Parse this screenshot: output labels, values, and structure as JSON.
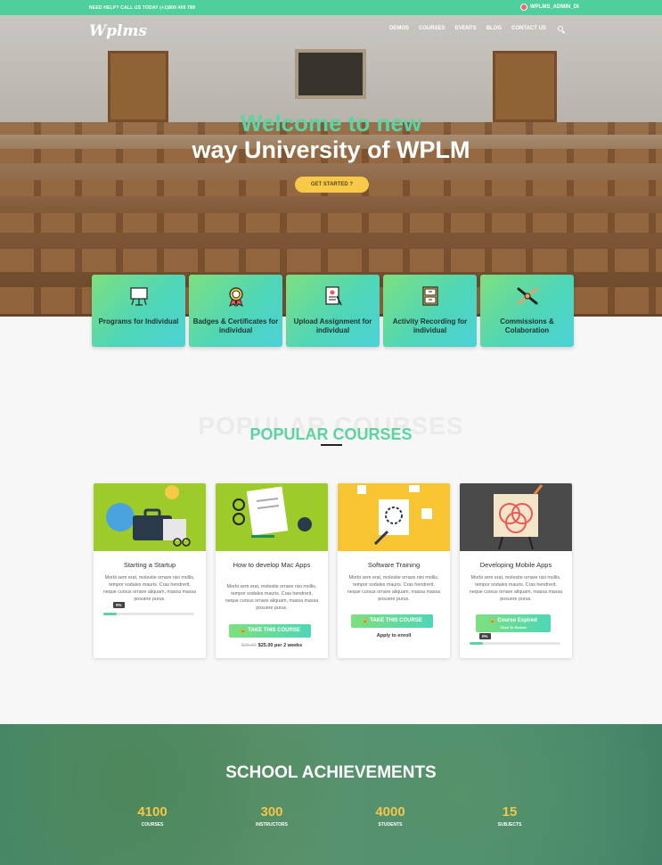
{
  "topbar": {
    "call": "NEED HELP? CALL US TODAY (+1)800 400 789",
    "user": "WPLMS_ADMIN_DI"
  },
  "header": {
    "logo": "Wplms",
    "nav": [
      "DEMOS",
      "COURSES",
      "EVENTS",
      "BLOG",
      "CONTACT US"
    ]
  },
  "hero": {
    "line1": "Welcome to new",
    "line2": "way University of WPLM",
    "cta": "GET STARTED ?"
  },
  "features": [
    {
      "label": "Programs for Individual",
      "icon": "presentation-board-icon"
    },
    {
      "label": "Badges & Certificates for individual",
      "icon": "badge-ribbon-icon"
    },
    {
      "label": "Upload Assignment for individual",
      "icon": "document-upload-icon"
    },
    {
      "label": "Activity Recording for individual",
      "icon": "activity-cabinet-icon"
    },
    {
      "label": "Commissions & Colaboration",
      "icon": "handshake-icon"
    }
  ],
  "popular": {
    "shadow": "POPULAR COURSES",
    "title": "POPULAR COURSES"
  },
  "courses": [
    {
      "title": "Starting a Startup",
      "desc": "Morbi sem erat, molestie ornare nisi mollis, tempor sodales mauris. Cras hendrerit, neque cursus ornare aliquam, massa massa posuere purus.",
      "progress": "0%",
      "progress_value": 0.15,
      "color": "#9ccb2a"
    },
    {
      "title": "How to develop Mac Apps",
      "desc": "Morbi sem erat, molestie ornare nisi mollis, tempor sodales mauris. Cras hendrerit, neque cursus ornare aliquam, massa massa posuere purus.",
      "button": "TAKE THIS COURSE",
      "old_price": "$20.00",
      "price": "$25.00 per 2 weeks",
      "color": "#9ccb2a"
    },
    {
      "title": "Software Training",
      "desc": "Morbi sem erat, molestie ornare nisi mollis, tempor sodales mauris. Cras hendrerit, neque cursus ornare aliquam, massa massa posuere purus.",
      "button": "TAKE THIS COURSE",
      "note": "Apply to enroll",
      "color": "#f7c531"
    },
    {
      "title": "Developing Mobile Apps",
      "desc": "Morbi sem erat, molestie ornare nisi mollis, tempor sodales mauris. Cras hendrerit, neque cursus ornare aliquam, massa massa posuere purus.",
      "button": "Course Expired",
      "button_sub": "Click To Renew",
      "progress": "0%",
      "progress_value": 0.15,
      "color": "#4a4a4a"
    }
  ],
  "achievements": {
    "title": "SCHOOL ACHIEVEMENTS",
    "stats": [
      {
        "num": "4100",
        "label": "COURSES"
      },
      {
        "num": "300",
        "label": "INSTRUCTORS"
      },
      {
        "num": "4000",
        "label": "STUDENTS"
      },
      {
        "num": "15",
        "label": "SUBJECTS"
      }
    ]
  }
}
